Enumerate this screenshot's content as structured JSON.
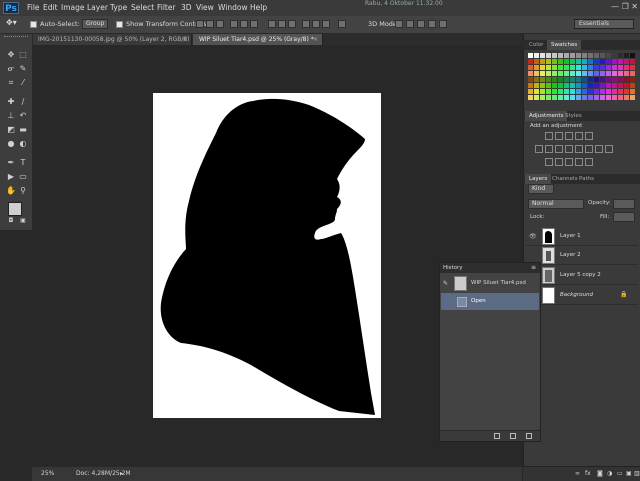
{
  "app": {
    "logo": "Ps",
    "clock": "Rabu, 4 Oktober 11.32.00"
  },
  "menu": [
    "File",
    "Edit",
    "Image",
    "Layer",
    "Type",
    "Select",
    "Filter",
    "3D",
    "View",
    "Window",
    "Help"
  ],
  "window_controls": "— ❐ ✕",
  "options_bar": {
    "auto_select_label": "Auto-Select:",
    "auto_select_value": "Group",
    "transform_label": "Show Transform Controls",
    "mode_3d_label": "3D Mode:",
    "workspace": "Essentials"
  },
  "tabs": [
    {
      "label": "IMG-20151130-00058.jpg @ 50% (Layer 2, RGB/8) *",
      "active": false
    },
    {
      "label": "WIP Siluet Tiar4.psd @ 25% (Gray/8) *",
      "active": true
    }
  ],
  "status": {
    "zoom": "25%",
    "doc": "Doc: 4,28M/25,2M"
  },
  "panels": {
    "color_tabs": [
      "Color",
      "Swatches"
    ],
    "adjust_tabs": [
      "Adjustments",
      "Styles"
    ],
    "adjust_title": "Add an adjustment",
    "layers_tabs": [
      "Layers",
      "Channels",
      "Paths"
    ],
    "layers_kind": "Kind",
    "blend_mode": "Normal",
    "opacity_label": "Opacity:",
    "lock_label": "Lock:",
    "fill_label": "Fill:",
    "layers": [
      "Layer 1",
      "Layer 2",
      "Layer 5 copy 2",
      "Background"
    ]
  },
  "history": {
    "title": "History",
    "snapshot": "WIP Siluet Tiar4.psd",
    "steps": [
      "Open"
    ]
  },
  "icons": {
    "tools": [
      "move-icon",
      "marquee-icon",
      "lasso-icon",
      "quick-select-icon",
      "crop-icon",
      "eyedropper-icon",
      "healing-icon",
      "brush-icon",
      "stamp-icon",
      "history-brush-icon",
      "eraser-icon",
      "gradient-icon",
      "blur-icon",
      "dodge-icon",
      "pen-icon",
      "type-icon",
      "path-select-icon",
      "shape-icon",
      "hand-icon",
      "zoom-icon"
    ]
  },
  "colors": {
    "accent_selected": "#5b6a85",
    "panel": "#3a3a3a",
    "canvas": "#282828"
  }
}
